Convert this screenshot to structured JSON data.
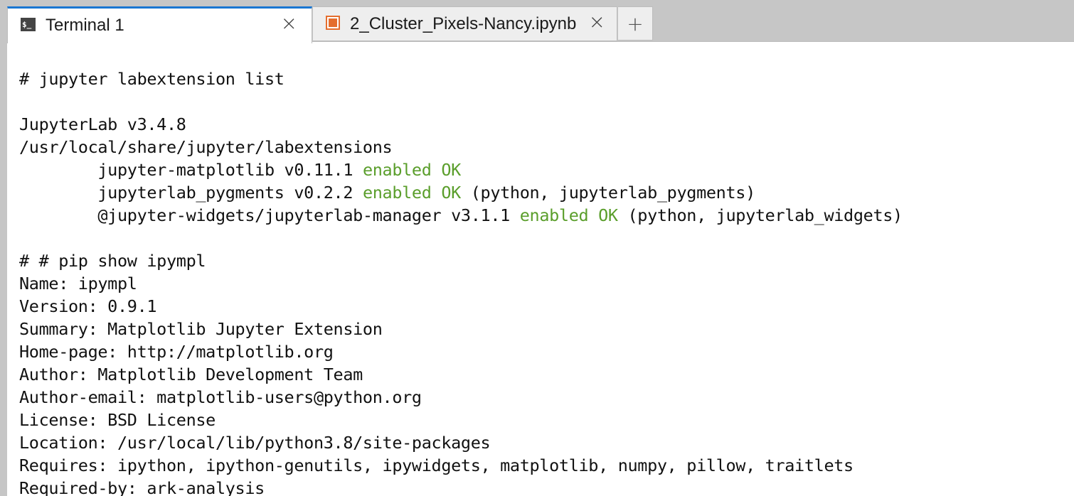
{
  "tabs": {
    "active": {
      "label": "Terminal 1",
      "icon": "terminal-icon",
      "close": "×"
    },
    "inactive": {
      "label": "2_Cluster_Pixels-Nancy.ipynb",
      "icon": "notebook-icon",
      "close": "×"
    },
    "add": "+"
  },
  "terminal": {
    "lines": [
      {
        "text": "# jupyter labextension list"
      },
      {
        "text": ""
      },
      {
        "text": "JupyterLab v3.4.8"
      },
      {
        "text": "/usr/local/share/jupyter/labextensions"
      },
      {
        "text": "        jupyter-matplotlib v0.11.1 ",
        "ok": "enabled OK",
        "rest": ""
      },
      {
        "text": "        jupyterlab_pygments v0.2.2 ",
        "ok": "enabled OK",
        "rest": " (python, jupyterlab_pygments)"
      },
      {
        "text": "        @jupyter-widgets/jupyterlab-manager v3.1.1 ",
        "ok": "enabled OK",
        "rest": " (python, jupyterlab_widgets)"
      },
      {
        "text": ""
      },
      {
        "text": "# # pip show ipympl"
      },
      {
        "text": "Name: ipympl"
      },
      {
        "text": "Version: 0.9.1"
      },
      {
        "text": "Summary: Matplotlib Jupyter Extension"
      },
      {
        "text": "Home-page: http://matplotlib.org"
      },
      {
        "text": "Author: Matplotlib Development Team"
      },
      {
        "text": "Author-email: matplotlib-users@python.org"
      },
      {
        "text": "License: BSD License"
      },
      {
        "text": "Location: /usr/local/lib/python3.8/site-packages"
      },
      {
        "text": "Requires: ipython, ipython-genutils, ipywidgets, matplotlib, numpy, pillow, traitlets"
      },
      {
        "text": "Required-by: ark-analysis"
      }
    ]
  },
  "colors": {
    "ok": "#5a9e2b",
    "active_tab_accent": "#1976d2",
    "notebook_icon": "#e46e2e"
  }
}
